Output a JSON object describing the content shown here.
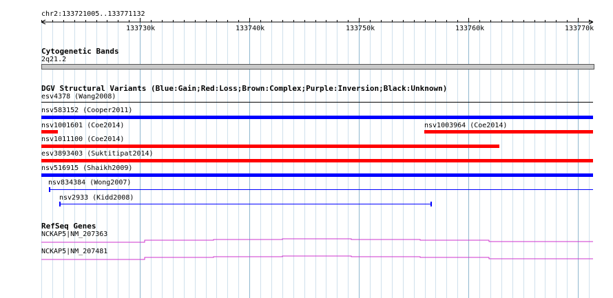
{
  "ruler": {
    "region": "chr2:133721005..133771132",
    "ticks": [
      "133730k",
      "133740k",
      "133750k",
      "133760k",
      "133770k"
    ]
  },
  "cytobands": {
    "title": "Cytogenetic Bands",
    "band": "2q21.2"
  },
  "dgv": {
    "title": "DGV Structural Variants (Blue:Gain;Red:Loss;Brown:Complex;Purple:Inversion;Black:Unknown)",
    "colors": {
      "gain": "#0000ff",
      "loss": "#ff0000"
    },
    "variants": [
      {
        "label": "esv4378 (Wang2008)",
        "type": "unknown"
      },
      {
        "label": "nsv583152 (Cooper2011)",
        "type": "gain"
      },
      {
        "label": "nsv1001601 (Coe2014)",
        "type": "loss"
      },
      {
        "label": "nsv1003964 (Coe2014)",
        "type": "loss"
      },
      {
        "label": "nsv1011100 (Coe2014)",
        "type": "loss"
      },
      {
        "label": "esv3893403 (Suktitipat2014)",
        "type": "loss"
      },
      {
        "label": "nsv516915 (Shaikh2009)",
        "type": "gain"
      },
      {
        "label": "nsv834384 (Wong2007)",
        "type": "gain"
      },
      {
        "label": "nsv2933 (Kidd2008)",
        "type": "gain"
      }
    ]
  },
  "refseq": {
    "title": "RefSeq Genes",
    "color": "#cc33cc",
    "genes": [
      {
        "label": "NCKAP5|NM_207363"
      },
      {
        "label": "NCKAP5|NM_207481"
      }
    ]
  }
}
